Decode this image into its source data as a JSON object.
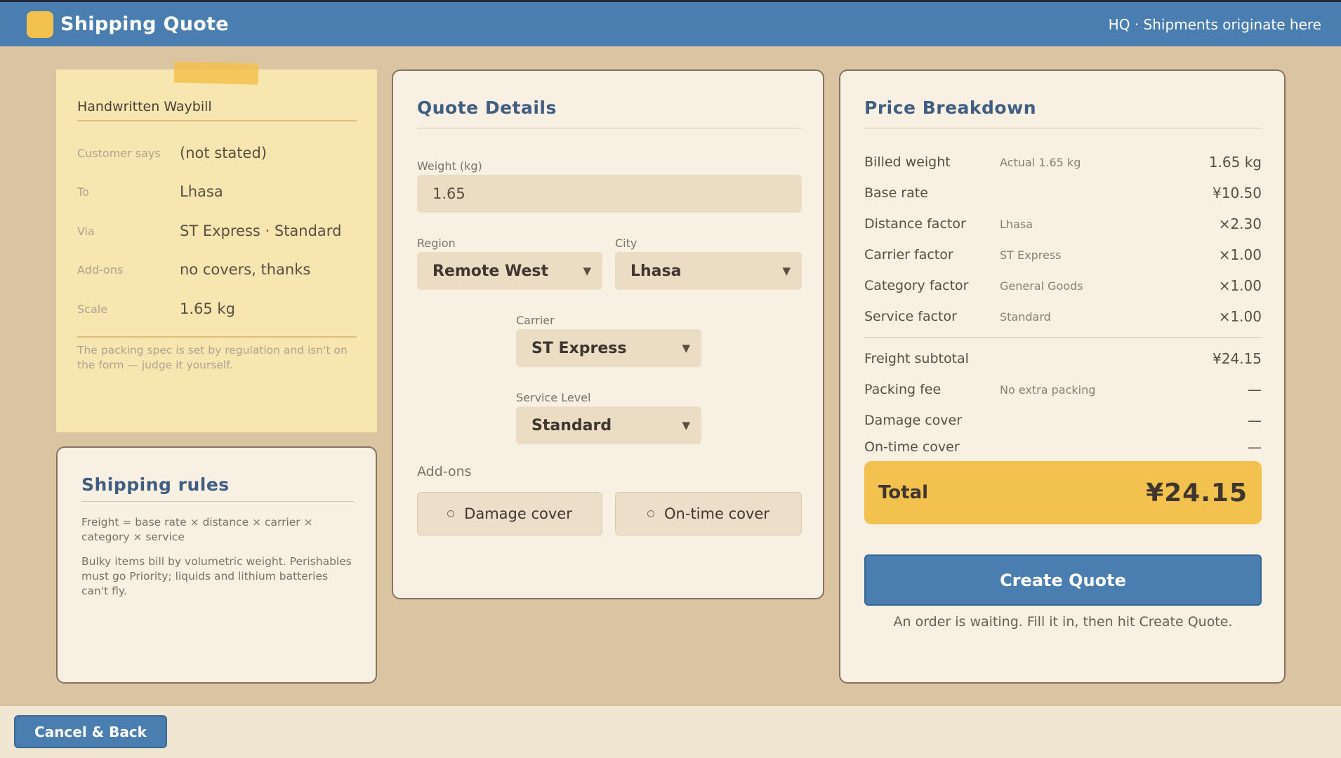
{
  "app": {
    "title": "Shipping Quote",
    "hq_note": "HQ · Shipments originate here",
    "accent": "#4a7eb0",
    "highlight": "#f2c14e"
  },
  "waybill": {
    "title": "Handwritten Waybill",
    "rows": [
      {
        "label": "Customer says",
        "value": "(not stated)"
      },
      {
        "label": "To",
        "value": "Lhasa"
      },
      {
        "label": "Via",
        "value": "ST Express · Standard"
      },
      {
        "label": "Add-ons",
        "value": "no covers, thanks"
      },
      {
        "label": "Scale",
        "value": "1.65 kg"
      }
    ],
    "note": "The packing spec is set by regulation and isn't on the form — judge it yourself."
  },
  "rules": {
    "title": "Shipping rules",
    "formula": "Freight = base rate × distance × carrier × category × service",
    "detail": "Bulky items bill by volumetric weight. Perishables must go Priority; liquids and lithium batteries can't fly."
  },
  "quote": {
    "title": "Quote Details",
    "weight_label": "Weight (kg)",
    "weight_value": "1.65",
    "region_label": "Region",
    "region_value": "Remote West",
    "city_label": "City",
    "city_value": "Lhasa",
    "carrier_label": "Carrier",
    "carrier_value": "ST Express",
    "service_label": "Service Level",
    "service_value": "Standard",
    "addons_label": "Add-ons",
    "addon_damage": "Damage cover",
    "addon_ontime": "On-time cover",
    "chevron": "▼",
    "radio_icon": "radio-unchecked"
  },
  "price": {
    "title": "Price Breakdown",
    "rows": [
      {
        "name": "Billed weight",
        "detail": "Actual 1.65 kg",
        "value": "1.65 kg"
      },
      {
        "name": "Base rate",
        "detail": "",
        "value": "¥10.50"
      },
      {
        "name": "Distance factor",
        "detail": "Lhasa",
        "value": "×2.30"
      },
      {
        "name": "Carrier factor",
        "detail": "ST Express",
        "value": "×1.00"
      },
      {
        "name": "Category factor",
        "detail": "General Goods",
        "value": "×1.00"
      },
      {
        "name": "Service factor",
        "detail": "Standard",
        "value": "×1.00"
      }
    ],
    "extras": [
      {
        "name": "Freight subtotal",
        "detail": "",
        "value": "¥24.15"
      },
      {
        "name": "Packing fee",
        "detail": "No extra packing",
        "value": "—"
      },
      {
        "name": "Damage cover",
        "detail": "",
        "value": "—"
      },
      {
        "name": "On-time cover",
        "detail": "",
        "value": "—"
      }
    ],
    "total_label": "Total",
    "total_value": "¥24.15",
    "create_label": "Create Quote",
    "hint": "An order is waiting. Fill it in, then hit Create Quote."
  },
  "footer": {
    "cancel_label": "Cancel & Back"
  }
}
